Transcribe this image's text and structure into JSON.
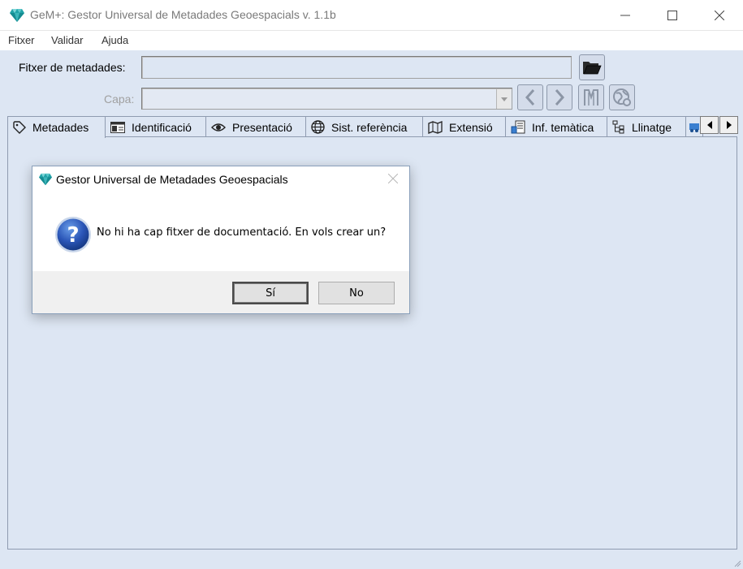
{
  "window": {
    "title": "GeM+: Gestor Universal de Metadades Geoespacials v. 1.1b",
    "icon": "diamond-icon",
    "controls": [
      "minimize-icon",
      "maximize-icon",
      "close-icon"
    ]
  },
  "menu": {
    "items": [
      "Fitxer",
      "Validar",
      "Ajuda"
    ]
  },
  "form": {
    "file_label": "Fitxer de metadades:",
    "file_value": "",
    "layer_label": "Capa:",
    "layer_value": ""
  },
  "tabs": [
    {
      "label": "Metadades",
      "icon": "tag-icon",
      "active": true
    },
    {
      "label": "Identificació",
      "icon": "id-card-icon"
    },
    {
      "label": "Presentació",
      "icon": "eye-icon"
    },
    {
      "label": "Sist. referència",
      "icon": "globe-grid-icon"
    },
    {
      "label": "Extensió",
      "icon": "map-icon"
    },
    {
      "label": "Inf. temàtica",
      "icon": "thematic-icon"
    },
    {
      "label": "Llinatge",
      "icon": "tree-icon"
    }
  ],
  "dialog": {
    "title": "Gestor Universal de Metadades Geoespacials",
    "message": "No hi ha cap fitxer de documentació. En vols crear un?",
    "buttons": {
      "yes": "Sí",
      "no": "No"
    },
    "icon": "question-icon"
  },
  "colors": {
    "background": "#dde6f3",
    "accent": "#1e9aa0",
    "question": "#2b56b8"
  }
}
